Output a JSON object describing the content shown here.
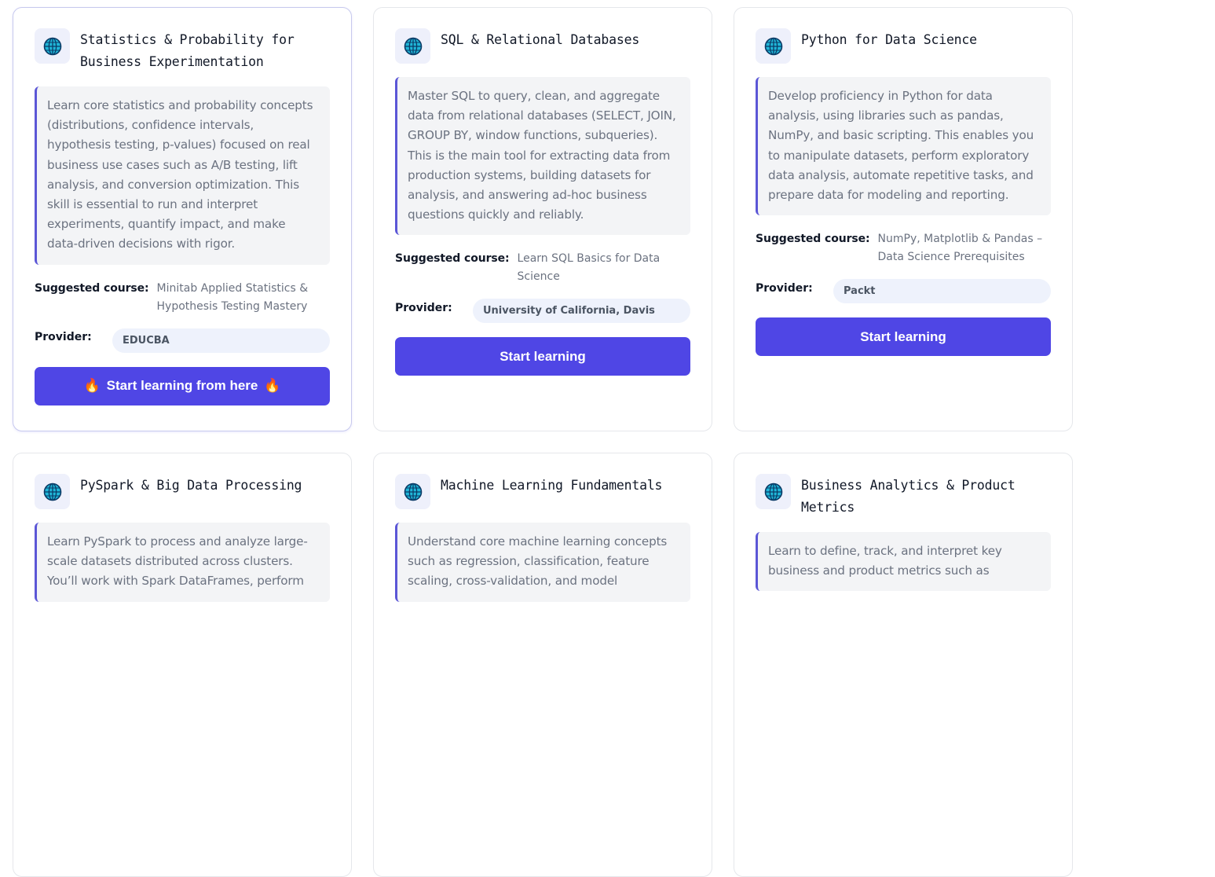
{
  "colors": {
    "accent": "#4f46e5",
    "desc_border": "#5b56d6",
    "chip_bg": "#eef2fc",
    "desc_bg": "#f3f4f6"
  },
  "labels": {
    "suggested": "Suggested course:",
    "provider": "Provider:"
  },
  "cards": [
    {
      "icon": "globe-icon",
      "title": "Statistics & Probability for Business Experimentation",
      "description": "Learn core statistics and probability concepts (distributions, confidence intervals, hypothesis testing, p-values) focused on real business use cases such as A/B testing, lift analysis, and conversion optimization. This skill is essential to run and interpret experiments, quantify impact, and make data-driven decisions with rigor.",
      "course": "Minitab Applied Statistics & Hypothesis Testing Mastery",
      "provider": "EDUCBA",
      "button": "Start learning from here",
      "button_emoji": "🔥"
    },
    {
      "icon": "globe-icon",
      "title": "SQL & Relational Databases",
      "description": "Master SQL to query, clean, and aggregate data from relational databases (SELECT, JOIN, GROUP BY, window functions, subqueries). This is the main tool for extracting data from production systems, building datasets for analysis, and answering ad-hoc business questions quickly and reliably.",
      "course": "Learn SQL Basics for Data Science",
      "provider": "University of California, Davis",
      "button": "Start learning"
    },
    {
      "icon": "globe-icon",
      "title": "Python for Data Science",
      "description": "Develop proficiency in Python for data analysis, using libraries such as pandas, NumPy, and basic scripting. This enables you to manipulate datasets, perform exploratory data analysis, automate repetitive tasks, and prepare data for modeling and reporting.",
      "course": "NumPy, Matplotlib & Pandas – Data Science Prerequisites",
      "provider": "Packt",
      "button": "Start learning"
    },
    {
      "icon": "globe-icon",
      "title": "PySpark & Big Data Processing",
      "description": "Learn PySpark to process and analyze large-scale datasets distributed across clusters. You’ll work with Spark DataFrames, perform"
    },
    {
      "icon": "globe-icon",
      "title": "Machine Learning Fundamentals",
      "description": "Understand core machine learning concepts such as regression, classification, feature scaling, cross-validation, and model"
    },
    {
      "icon": "globe-icon",
      "title": "Business Analytics & Product Metrics",
      "description": "Learn to define, track, and interpret key business and product metrics such as"
    }
  ]
}
